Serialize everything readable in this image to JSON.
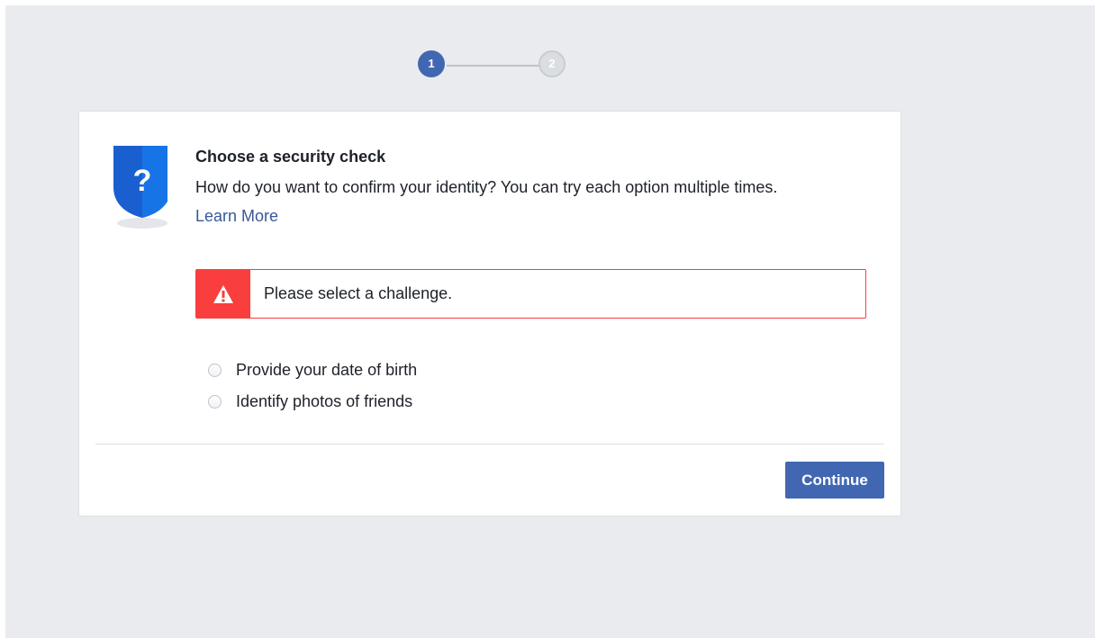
{
  "stepper": {
    "steps": [
      {
        "label": "1",
        "state": "active",
        "color": "#4267b2"
      },
      {
        "label": "2",
        "state": "inactive",
        "color": "#dadde1"
      }
    ]
  },
  "dialog": {
    "icon": "question-shield-icon",
    "title": "Choose a security check",
    "description": "How do you want to confirm your identity? You can try each option multiple times.",
    "learn_more": "Learn More",
    "error": {
      "icon": "warning-triangle-icon",
      "message": "Please select a challenge.",
      "color": "#fa3e3e"
    },
    "options": [
      {
        "label": "Provide your date of birth",
        "selected": false
      },
      {
        "label": "Identify photos of friends",
        "selected": false
      }
    ],
    "continue_label": "Continue"
  },
  "colors": {
    "background": "#e9ebee",
    "accent": "#4267b2",
    "link": "#385898"
  }
}
